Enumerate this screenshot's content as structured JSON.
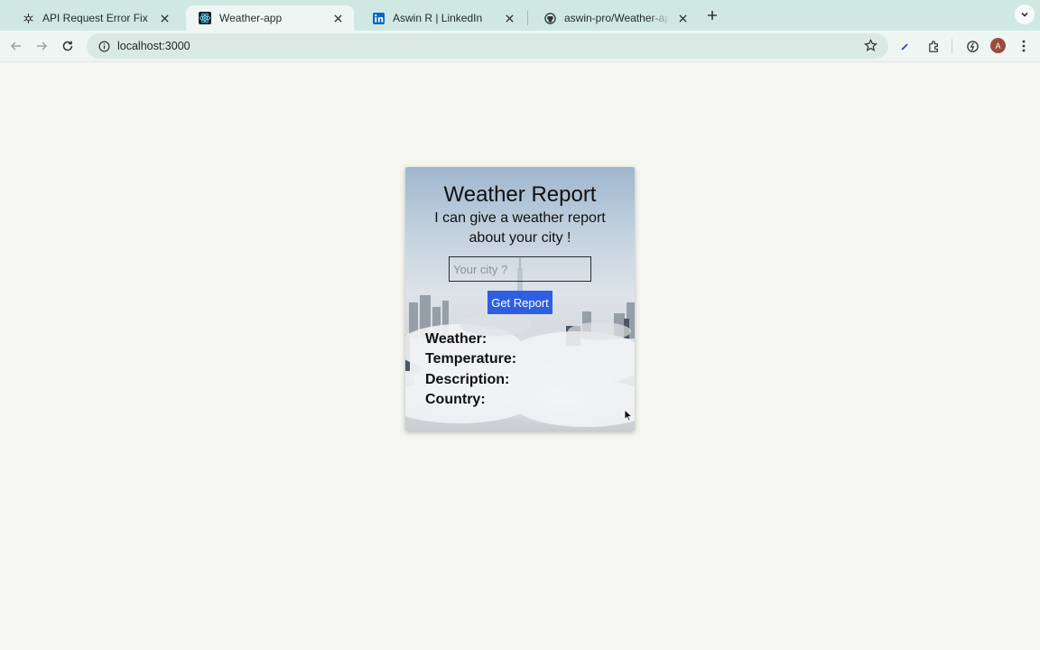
{
  "browser": {
    "tabs": [
      {
        "title": "API Request Error Fix",
        "icon": "openai-icon",
        "active": false
      },
      {
        "title": "Weather-app",
        "icon": "react-icon",
        "active": true
      },
      {
        "title": "Aswin R | LinkedIn",
        "icon": "linkedin-icon",
        "active": false
      },
      {
        "title": "aswin-pro/Weather-app-reac",
        "icon": "github-icon",
        "active": false
      }
    ],
    "url": "localhost:3000",
    "profile_initial": "A",
    "accent_color": "#cfe9e2"
  },
  "app": {
    "title": "Weather Report",
    "subtitle": "I can give a weather report about your city !",
    "input_placeholder": "Your city ?",
    "input_value": "",
    "button_label": "Get Report",
    "fields": {
      "weather": "Weather:",
      "temperature": "Temperature:",
      "description": "Description:",
      "country": "Country:"
    },
    "button_color": "#2f5fe0"
  }
}
